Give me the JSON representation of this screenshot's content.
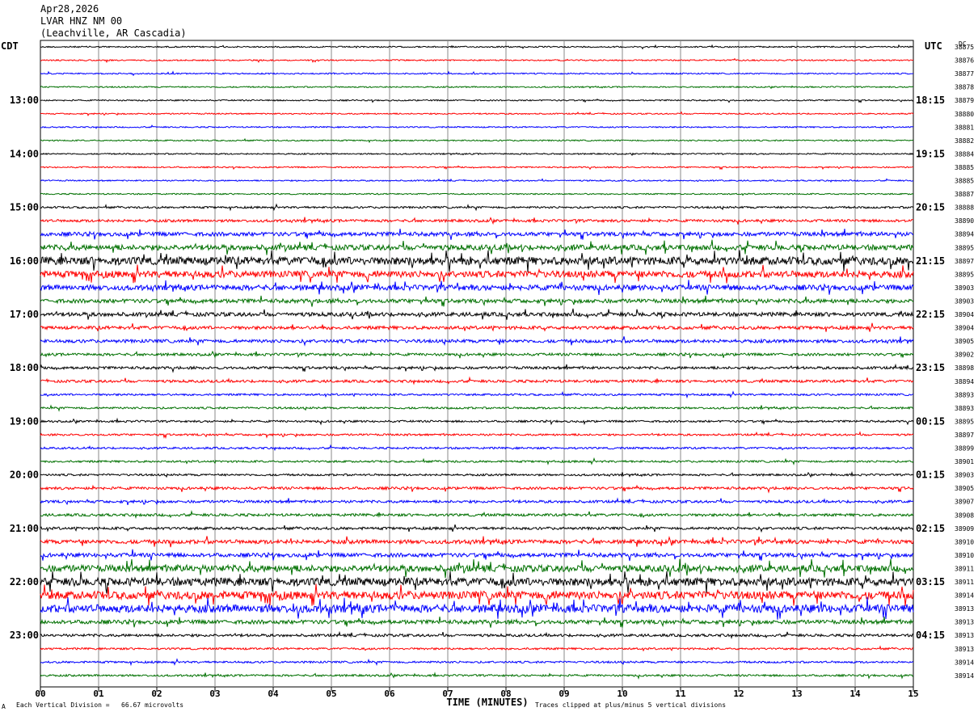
{
  "header": {
    "date": "Apr28,2026",
    "station": "LVAR HNZ NM 00",
    "location": "(Leachville, AR Cascadia)"
  },
  "left_tz": "CDT",
  "right_tz": "UTC",
  "dc_label": "DC",
  "footer": {
    "scale_note": "Each Vertical Division =   66.67 microvolts",
    "clip_note": "Traces clipped at plus/minus 5 vertical divisions",
    "corner_mark": "A"
  },
  "chart_data": {
    "type": "line",
    "xlabel": "TIME (MINUTES)",
    "xlim": [
      0,
      15
    ],
    "x_ticks": [
      "00",
      "01",
      "02",
      "03",
      "04",
      "05",
      "06",
      "07",
      "08",
      "09",
      "10",
      "11",
      "12",
      "13",
      "14",
      "15"
    ],
    "row_count": 48,
    "trace_colors": [
      "#000000",
      "#ff0000",
      "#0000ff",
      "#007000"
    ],
    "left_hour_labels": [
      "13:00",
      "14:00",
      "15:00",
      "16:00",
      "17:00",
      "18:00",
      "19:00",
      "20:00",
      "21:00",
      "22:00",
      "23:00"
    ],
    "right_hour_labels": [
      "18:15",
      "19:15",
      "20:15",
      "21:15",
      "22:15",
      "23:15",
      "00:15",
      "01:15",
      "02:15",
      "03:15",
      "04:15"
    ],
    "hour_label_first_row": 4,
    "rows_per_hour": 4,
    "dc_values": [
      "38875",
      "38876",
      "38877",
      "38878",
      "38879",
      "38880",
      "38881",
      "38882",
      "38884",
      "38885",
      "38885",
      "38887",
      "38888",
      "38890",
      "38894",
      "38895",
      "38897",
      "38895",
      "38903",
      "38903",
      "38904",
      "38904",
      "38905",
      "38902",
      "38898",
      "38894",
      "38893",
      "38893",
      "38895",
      "38897",
      "38899",
      "38901",
      "38903",
      "38905",
      "38907",
      "38908",
      "38909",
      "38910",
      "38910",
      "38911",
      "38911",
      "38914",
      "38913",
      "38913",
      "38913",
      "38913",
      "38914",
      "38914"
    ],
    "row_noise_level": [
      1,
      1,
      1,
      1,
      1,
      1,
      1,
      1,
      1,
      1,
      1,
      1,
      1.5,
      2,
      3,
      4,
      6,
      5,
      4,
      3,
      3,
      2.5,
      2.5,
      2,
      2,
      2,
      1.5,
      1.5,
      1.5,
      1.5,
      1.5,
      1.5,
      1.5,
      2,
      2,
      2,
      2,
      3,
      3,
      5,
      6,
      6,
      6,
      3,
      2,
      1.5,
      1.5,
      1.5
    ]
  }
}
